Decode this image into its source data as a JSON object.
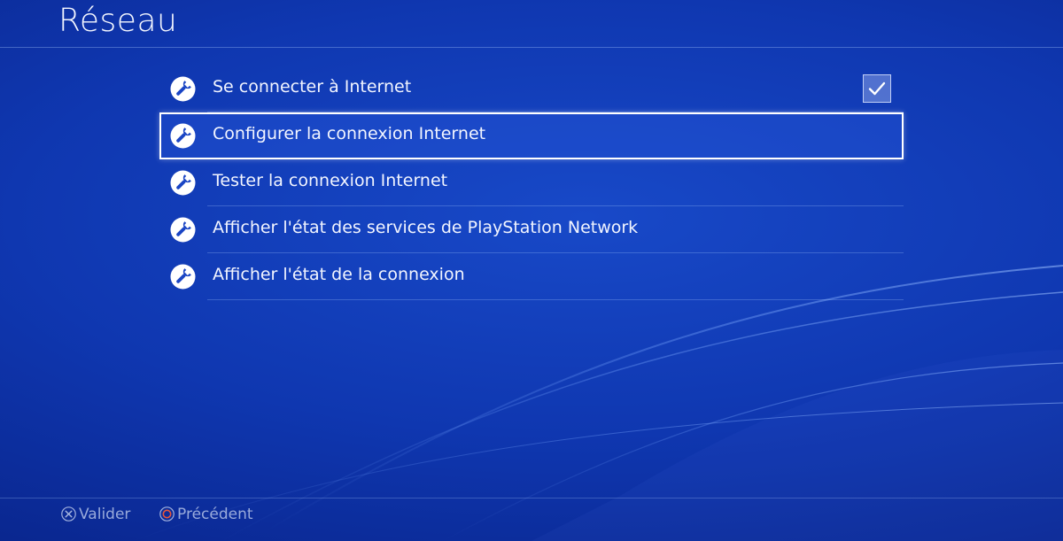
{
  "header": {
    "title": "Réseau"
  },
  "menu": {
    "items": [
      {
        "label": "Se connecter à Internet",
        "icon": "wrench-icon",
        "checked": true
      },
      {
        "label": "Configurer la connexion Internet",
        "icon": "wrench-icon",
        "focused": true
      },
      {
        "label": "Tester la connexion Internet",
        "icon": "wrench-icon"
      },
      {
        "label": "Afficher l'état des services de PlayStation Network",
        "icon": "wrench-icon"
      },
      {
        "label": "Afficher l'état de la connexion",
        "icon": "wrench-icon"
      }
    ]
  },
  "footer": {
    "confirm": {
      "icon": "cross-button-icon",
      "label": "Valider"
    },
    "back": {
      "icon": "circle-button-icon",
      "label": "Précédent"
    }
  },
  "colors": {
    "background": "#0f37b0",
    "focus_border": "#ffffff",
    "circle_button": "#e8553a"
  }
}
